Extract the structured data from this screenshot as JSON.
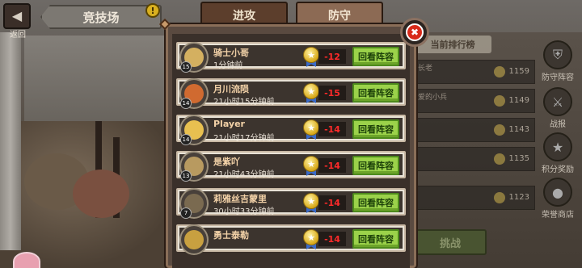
{
  "hud": {
    "back_label": "返回",
    "back_glyph": "◀",
    "title": "竞技场",
    "info_glyph": "!"
  },
  "tabs": [
    {
      "label": "进攻",
      "selected": false
    },
    {
      "label": "防守",
      "selected": true
    }
  ],
  "close_glyph": "✖",
  "records": [
    {
      "name": "骑士小哥",
      "time": "1分钟前",
      "level": "15",
      "delta": "-12",
      "button": "回看阵容",
      "face_color": "#d4b060"
    },
    {
      "name": "月川流陨",
      "time": "21小时15分钟前",
      "level": "14",
      "delta": "-15",
      "button": "回看阵容",
      "face_color": "#d06a30"
    },
    {
      "name": "Player",
      "time": "21小时17分钟前",
      "level": "14",
      "delta": "-14",
      "button": "回看阵容",
      "face_color": "#e8c050"
    },
    {
      "name": "是紫吖",
      "time": "21小时43分钟前",
      "level": "13",
      "delta": "-14",
      "button": "回看阵容",
      "face_color": "#b89a60"
    },
    {
      "name": "莉雅丝吉蒙里",
      "time": "30小时33分钟前",
      "level": "7",
      "delta": "-14",
      "button": "回看阵容",
      "face_color": "#7a6a50"
    },
    {
      "name": "勇士泰勒",
      "time": "",
      "level": "",
      "delta": "-14",
      "button": "回看阵容",
      "face_color": "#c8a040"
    }
  ],
  "leaderboard": {
    "title": "当前排行榜",
    "rows": [
      {
        "name": "长老",
        "score": "1159"
      },
      {
        "name": "爱的小兵",
        "score": "1149"
      },
      {
        "name": "",
        "score": "1143"
      },
      {
        "name": "",
        "score": "1135"
      },
      {
        "name": "",
        "score": "1123"
      }
    ],
    "challenge": "挑战"
  },
  "side_buttons": [
    {
      "label": "防守阵容",
      "icon": "shield-icon",
      "glyph": "⛨"
    },
    {
      "label": "战报",
      "icon": "swords-icon",
      "glyph": "⚔"
    },
    {
      "label": "积分奖励",
      "icon": "reward-icon",
      "glyph": "★"
    },
    {
      "label": "荣誉商店",
      "icon": "shop-icon",
      "glyph": "●"
    }
  ],
  "colors": {
    "replay_button": "#9bd24a",
    "delta_text": "#ff2a2a",
    "close_button": "#d82a1a",
    "medal_ribbon": "#3a6ac8"
  }
}
